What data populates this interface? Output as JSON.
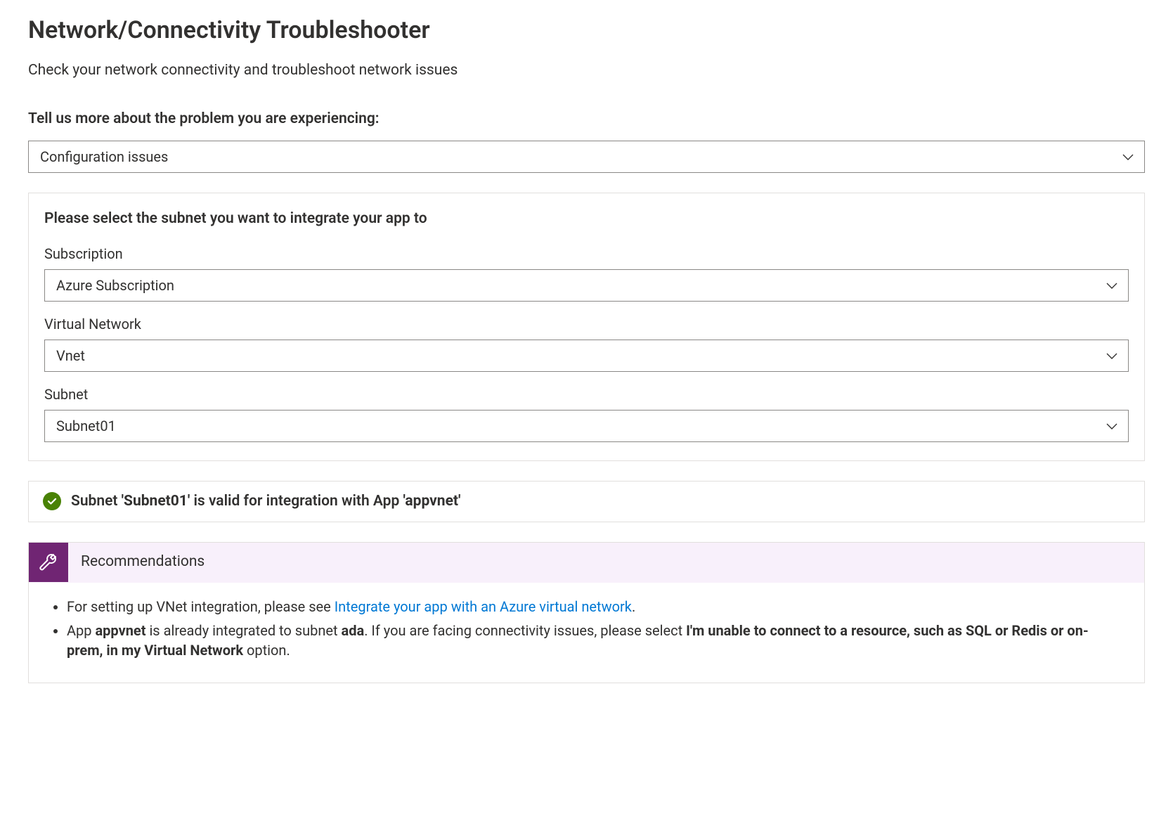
{
  "title": "Network/Connectivity Troubleshooter",
  "subtitle": "Check your network connectivity and troubleshoot network issues",
  "problem": {
    "label": "Tell us more about the problem you are experiencing:",
    "value": "Configuration issues"
  },
  "subnet_panel": {
    "heading": "Please select the subnet you want to integrate your app to",
    "subscription_label": "Subscription",
    "subscription_value": "Azure Subscription",
    "vnet_label": "Virtual Network",
    "vnet_value": "Vnet",
    "subnet_label": "Subnet",
    "subnet_value": "Subnet01"
  },
  "status": {
    "pre": "Subnet ",
    "subnet_quoted": "'Subnet01'",
    "mid": " is valid for integration with App ",
    "app_quoted": "'appvnet'"
  },
  "recommendations": {
    "heading": "Recommendations",
    "item1_pre": "For setting up VNet integration, please see ",
    "item1_link": "Integrate your app with an Azure virtual network",
    "item1_post": ".",
    "item2_a": "App ",
    "item2_app": "appvnet",
    "item2_b": " is already integrated to subnet ",
    "item2_subnet": "ada",
    "item2_c": ". If you are facing connectivity issues, please select ",
    "item2_bold": "I'm unable to connect to a resource, such as SQL or Redis or on-prem, in my Virtual Network",
    "item2_d": " option."
  }
}
